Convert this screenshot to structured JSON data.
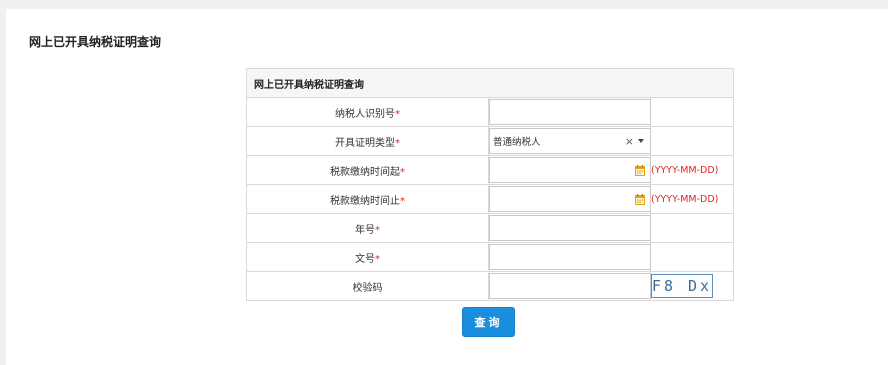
{
  "page": {
    "title": "网上已开具纳税证明查询"
  },
  "form": {
    "caption": "网上已开具纳税证明查询",
    "required_mark": "*",
    "fields": [
      {
        "label": "纳税人识别号",
        "required": true,
        "value": ""
      },
      {
        "label": "开具证明类型",
        "required": true,
        "value": "普通纳税人"
      },
      {
        "label": "税款缴纳时间起",
        "required": true,
        "value": "",
        "hint": "(YYYY-MM-DD)"
      },
      {
        "label": "税款缴纳时间止",
        "required": true,
        "value": "",
        "hint": "(YYYY-MM-DD)"
      },
      {
        "label": "年号",
        "required": true,
        "value": ""
      },
      {
        "label": "文号",
        "required": true,
        "value": ""
      },
      {
        "label": "校验码",
        "required": false,
        "value": ""
      }
    ],
    "captcha_text": "F8 Dx",
    "select_clear_symbol": "×",
    "calendar_icon": "calendar-icon"
  },
  "actions": {
    "query_label": "查询"
  },
  "colors": {
    "required": "#e02424",
    "hint": "#e02424",
    "button": "#1a8fe0",
    "calendar_icon": "#e8a317"
  }
}
